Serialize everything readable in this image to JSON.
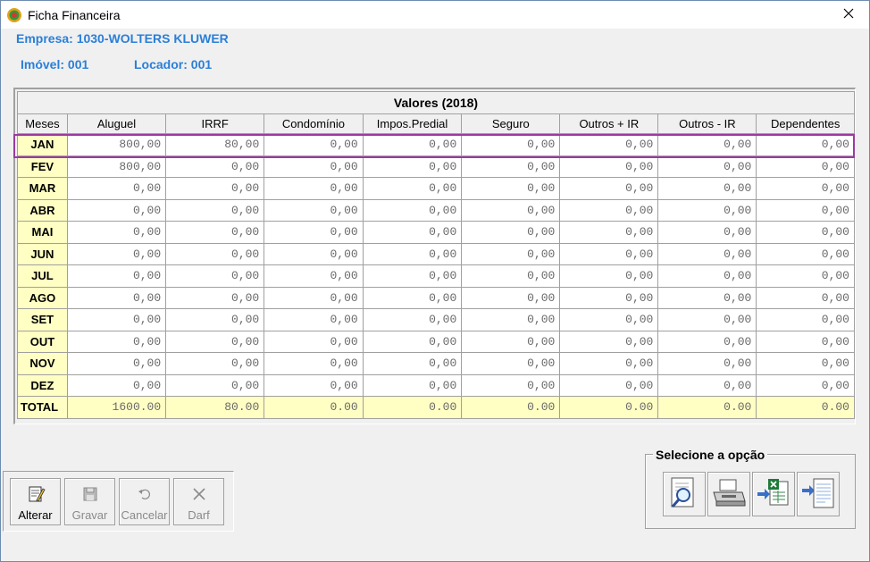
{
  "window": {
    "title": "Ficha Financeira"
  },
  "header": {
    "empresa": "Empresa: 1030-WOLTERS KLUWER",
    "imovel": "Imóvel: 001",
    "locador": "Locador: 001"
  },
  "table": {
    "caption": "Valores (2018)",
    "columns": [
      "Meses",
      "Aluguel",
      "IRRF",
      "Condomínio",
      "Impos.Predial",
      "Seguro",
      "Outros + IR",
      "Outros - IR",
      "Dependentes"
    ],
    "rows": [
      [
        "JAN",
        "800,00",
        "80,00",
        "0,00",
        "0,00",
        "0,00",
        "0,00",
        "0,00",
        "0,00"
      ],
      [
        "FEV",
        "800,00",
        "0,00",
        "0,00",
        "0,00",
        "0,00",
        "0,00",
        "0,00",
        "0,00"
      ],
      [
        "MAR",
        "0,00",
        "0,00",
        "0,00",
        "0,00",
        "0,00",
        "0,00",
        "0,00",
        "0,00"
      ],
      [
        "ABR",
        "0,00",
        "0,00",
        "0,00",
        "0,00",
        "0,00",
        "0,00",
        "0,00",
        "0,00"
      ],
      [
        "MAI",
        "0,00",
        "0,00",
        "0,00",
        "0,00",
        "0,00",
        "0,00",
        "0,00",
        "0,00"
      ],
      [
        "JUN",
        "0,00",
        "0,00",
        "0,00",
        "0,00",
        "0,00",
        "0,00",
        "0,00",
        "0,00"
      ],
      [
        "JUL",
        "0,00",
        "0,00",
        "0,00",
        "0,00",
        "0,00",
        "0,00",
        "0,00",
        "0,00"
      ],
      [
        "AGO",
        "0,00",
        "0,00",
        "0,00",
        "0,00",
        "0,00",
        "0,00",
        "0,00",
        "0,00"
      ],
      [
        "SET",
        "0,00",
        "0,00",
        "0,00",
        "0,00",
        "0,00",
        "0,00",
        "0,00",
        "0,00"
      ],
      [
        "OUT",
        "0,00",
        "0,00",
        "0,00",
        "0,00",
        "0,00",
        "0,00",
        "0,00",
        "0,00"
      ],
      [
        "NOV",
        "0,00",
        "0,00",
        "0,00",
        "0,00",
        "0,00",
        "0,00",
        "0,00",
        "0,00"
      ],
      [
        "DEZ",
        "0,00",
        "0,00",
        "0,00",
        "0,00",
        "0,00",
        "0,00",
        "0,00",
        "0,00"
      ]
    ],
    "total": [
      "TOTAL",
      "1600.00",
      "80.00",
      "0.00",
      "0.00",
      "0.00",
      "0.00",
      "0.00",
      "0.00"
    ]
  },
  "toolbar": {
    "alterar": "Alterar",
    "gravar": "Gravar",
    "cancelar": "Cancelar",
    "darf": "Darf"
  },
  "options": {
    "legend": "Selecione a opção"
  },
  "icons": {
    "app": "app-globe-icon",
    "close": "close-icon",
    "alterar": "edit-document-icon",
    "gravar": "save-disk-icon",
    "cancelar": "undo-icon",
    "darf": "x-icon",
    "preview": "print-preview-icon",
    "print": "printer-icon",
    "excel": "export-excel-icon",
    "document": "export-document-icon"
  },
  "colors": {
    "accent_text": "#2a7fd8",
    "highlight_cell": "#ffffc4",
    "selection_border": "#9b3aa0"
  }
}
